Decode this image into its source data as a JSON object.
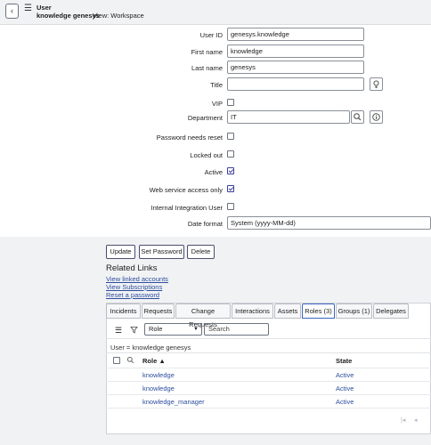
{
  "header": {
    "back_icon": "chevron-left-icon",
    "menu_icon": "menu-icon",
    "record_type": "User",
    "record_name": "knowledge genesys",
    "view_label": "View: Workspace"
  },
  "form": {
    "user_id": {
      "label": "User ID",
      "value": "genesys.knowledge"
    },
    "first_name": {
      "label": "First name",
      "value": "knowledge"
    },
    "last_name": {
      "label": "Last name",
      "value": "genesys"
    },
    "title": {
      "label": "Title",
      "value": ""
    },
    "vip": {
      "label": "VIP",
      "checked": false
    },
    "department": {
      "label": "Department",
      "value": "IT"
    },
    "password_needs_reset": {
      "label": "Password needs reset",
      "checked": false
    },
    "locked_out": {
      "label": "Locked out",
      "checked": false
    },
    "active": {
      "label": "Active",
      "checked": true
    },
    "web_service_access_only": {
      "label": "Web service access only",
      "checked": true
    },
    "internal_integration_user": {
      "label": "Internal Integration User",
      "checked": false
    },
    "date_format": {
      "label": "Date format",
      "value": "System (yyyy-MM-dd)"
    }
  },
  "actions": {
    "update": "Update",
    "set_password": "Set Password",
    "delete": "Delete"
  },
  "related_links": {
    "title": "Related Links",
    "links": [
      "View linked accounts",
      "View Subscriptions",
      "Reset a password"
    ]
  },
  "tabs": [
    {
      "label": "Incidents",
      "active": false
    },
    {
      "label": "Requests",
      "active": false
    },
    {
      "label": "Change Requests",
      "active": false
    },
    {
      "label": "Interactions",
      "active": false
    },
    {
      "label": "Assets",
      "active": false
    },
    {
      "label": "Roles (3)",
      "active": true
    },
    {
      "label": "Groups (1)",
      "active": false
    },
    {
      "label": "Delegates",
      "active": false
    }
  ],
  "list": {
    "search_field_value": "Role",
    "search_placeholder": "Search",
    "filter_breadcrumb": "User = knowledge genesys",
    "columns": {
      "role": "Role ▲",
      "state": "State"
    },
    "rows": [
      {
        "role": "knowledge",
        "state": "Active"
      },
      {
        "role": "knowledge",
        "state": "Active"
      },
      {
        "role": "knowledge_manager",
        "state": "Active"
      }
    ],
    "pager": {
      "first": "|◂",
      "prev": "◂"
    }
  },
  "colors": {
    "link": "#2c4d9e",
    "accent": "#3b3f9e",
    "header_bg": "#f1f2f4"
  }
}
